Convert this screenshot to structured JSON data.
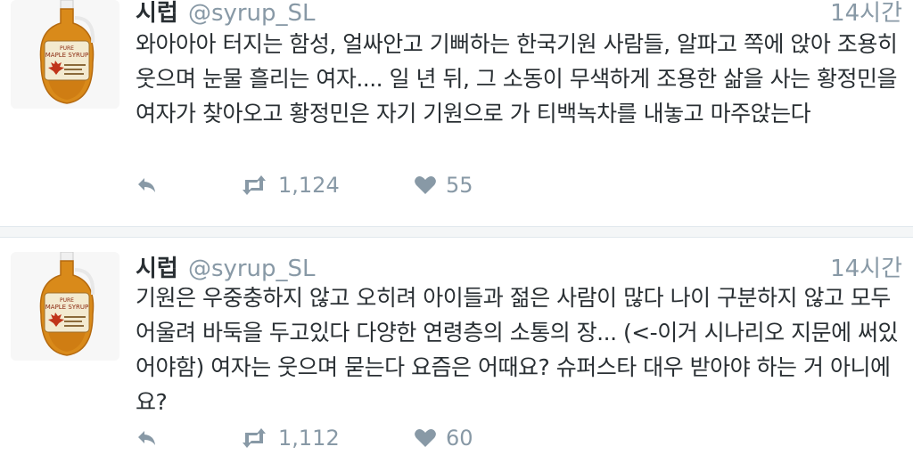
{
  "tweets": [
    {
      "name": "시럽",
      "handle": "@syrup_SL",
      "time": "14시간",
      "text": "와아아아 터지는 함성, 얼싸안고 기뻐하는 한국기원 사람들, 알파고 쪽에 앉아 조용히 웃으며 눈물 흘리는 여자.... 일 년 뒤, 그 소동이 무색하게 조용한 삶을 사는 황정민을 여자가 찾아오고 황정민은 자기 기원으로 가 티백녹차를 내놓고 마주앉는다",
      "retweets": "1,124",
      "likes": "55"
    },
    {
      "name": "시럽",
      "handle": "@syrup_SL",
      "time": "14시간",
      "text": "기원은 우중충하지 않고 오히려 아이들과 젊은 사람이 많다 나이 구분하지 않고 모두 어울려 바둑을 두고있다 다양한 연령층의 소통의 장... (<-이거 시나리오 지문에 써있어야함) 여자는 웃으며 묻는다 요즘은 어때요? 슈퍼스타 대우 받아야 하는 거 아니에요?",
      "retweets": "1,112",
      "likes": "60"
    }
  ],
  "icons": {
    "reply": "reply-icon",
    "retweet": "retweet-icon",
    "like": "heart-icon",
    "avatar": "maple-syrup-bottle-avatar"
  },
  "colors": {
    "text": "#292f33",
    "muted": "#8899a6",
    "divider": "#e1e8ed",
    "background": "#f4f6f7"
  }
}
